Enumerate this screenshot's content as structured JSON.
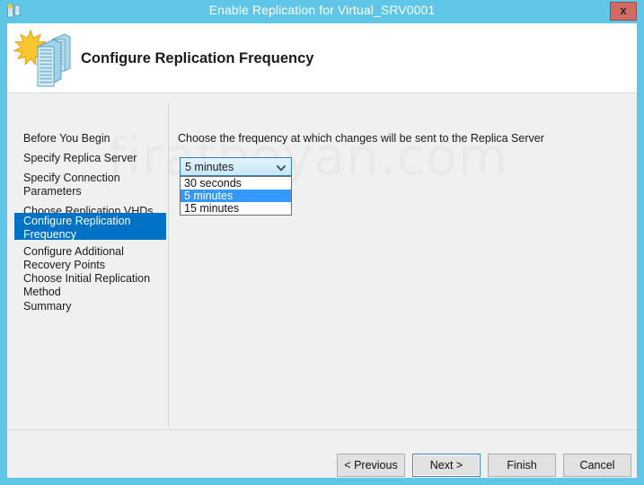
{
  "window": {
    "title": "Enable Replication for Virtual_SRV0001",
    "close_label": "x",
    "title_icon": "server-replication-icon"
  },
  "header": {
    "title": "Configure Replication Frequency",
    "icon": "two-servers-starburst-icon"
  },
  "watermark": {
    "text": "firatboyan.com"
  },
  "sidebar": {
    "items": [
      {
        "label": "Before You Begin",
        "selected": false
      },
      {
        "label": "Specify Replica Server",
        "selected": false
      },
      {
        "label": "Specify Connection\nParameters",
        "selected": false
      },
      {
        "label": "Choose Replication VHDs",
        "selected": false
      },
      {
        "label": "Configure Replication\nFrequency",
        "selected": true
      },
      {
        "label": "Configure Additional\nRecovery Points",
        "selected": false
      },
      {
        "label": "Choose Initial Replication\nMethod",
        "selected": false
      },
      {
        "label": "Summary",
        "selected": false
      }
    ]
  },
  "main": {
    "instruction": "Choose the frequency at which changes will be sent to the Replica Server",
    "frequency_combo": {
      "selected_value": "5 minutes",
      "arrow_icon": "chevron-down-icon",
      "expanded": true,
      "options": [
        {
          "label": "30 seconds",
          "highlighted": false
        },
        {
          "label": "5 minutes",
          "highlighted": true
        },
        {
          "label": "15 minutes",
          "highlighted": false
        }
      ]
    }
  },
  "footer": {
    "buttons": [
      {
        "label": "< Previous",
        "focused": false
      },
      {
        "label": "Next >",
        "focused": true
      },
      {
        "label": "Finish",
        "focused": false
      },
      {
        "label": "Cancel",
        "focused": false
      }
    ]
  },
  "colors": {
    "titlebar": "#5fc6e8",
    "accent_selected": "#0072c6",
    "list_highlight": "#3399ff",
    "close_button": "#cf6a64",
    "body": "#f0f0f0"
  }
}
